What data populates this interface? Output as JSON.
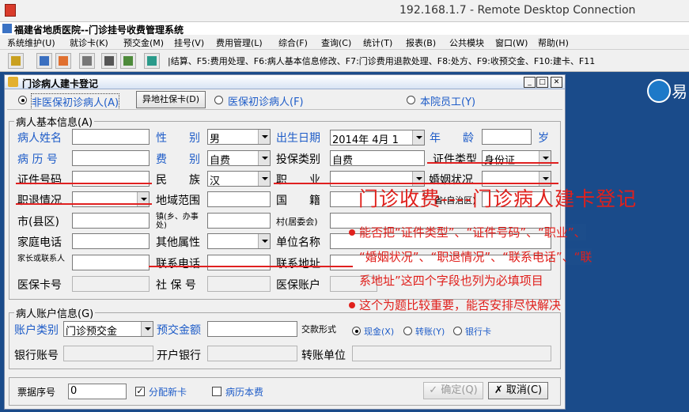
{
  "rdc": {
    "title": "192.168.1.7 - Remote Desktop Connection"
  },
  "app": {
    "title": "福建省地质医院--门诊挂号收费管理系统"
  },
  "menu": [
    "系统维护(U)",
    "就诊卡(K)",
    "预交金(M)",
    "挂号(V)",
    "费用管理(L)",
    "综合(F)",
    "查询(C)",
    "统计(T)",
    "报表(B)",
    "公共模块",
    "窗口(W)",
    "帮助(H)"
  ],
  "toolbar": {
    "hint": "|结算、F5:费用处理、F6:病人基本信息修改、F7:门诊费用退款处理、F8:处方、F9:收预交金、F10:建卡、F11"
  },
  "desktop": {
    "logo_text": "易"
  },
  "dialog": {
    "title": "门诊病人建卡登记",
    "radios": {
      "opt1": "非医保初诊病人(A)",
      "remote_btn": "异地社保卡(D)",
      "opt2": "医保初诊病人(F)",
      "opt3": "本院员工(Y)"
    },
    "basic": {
      "group": "病人基本信息(A)",
      "name": "病人姓名",
      "gender": "性　　别",
      "gender_val": "男",
      "birth": "出生日期",
      "birth_val": "2014年 4月 1",
      "age": "年　　龄",
      "age_unit": "岁",
      "record": "病 历 号",
      "feetype": "费　　别",
      "feetype_val": "自费",
      "insure": "投保类别",
      "insure_val": "自费",
      "idtype": "证件类型",
      "idtype_val": "身份证",
      "idno": "证件号码",
      "nation": "民　　族",
      "nation_val": "汉",
      "job": "职　　业",
      "marry": "婚姻状况",
      "retire": "职退情况",
      "area": "地域范围",
      "country": "国　　籍",
      "province": "省(自治区)",
      "city": "市(县区)",
      "town": "镇(乡、办事处)",
      "village": "村(居委会)",
      "homephone": "家庭电话",
      "other": "其他属性",
      "unit": "单位名称",
      "guardian": "家长或联系人",
      "contactphone": "联系电话",
      "contactaddr": "联系地址",
      "medcard": "医保卡号",
      "social": "社 保 号",
      "medacct": "医保账户"
    },
    "account": {
      "group": "病人账户信息(G)",
      "type": "账户类别",
      "type_val": "门诊预交金",
      "prepay": "预交金额",
      "payform": "交款形式",
      "cash": "现金(X)",
      "transfer": "转账(Y)",
      "bankcard": "银行卡",
      "bankno": "银行账号",
      "bank": "开户银行",
      "transunit": "转账单位"
    },
    "footer": {
      "receipt": "票据序号",
      "receipt_val": "0",
      "newcard": "分配新卡",
      "recordfee": "病历本费",
      "ok": "✓ 确定(Q)",
      "cancel": "✗ 取消(C)"
    }
  },
  "annotation": {
    "headline": "门诊收费----门诊病人建卡登记",
    "line1": "能否把“证件类型”、“证件号码”、“职业”、",
    "line2": "“婚姻状况”、“职退情况”、“联系电话”、“联",
    "line3": "系地址”这四个字段也列为必填项目",
    "line4": "这个为题比较重要，能否安排尽快解决"
  },
  "colors": {
    "annotation": "#e0201c",
    "label_blue": "#1e5cc8"
  }
}
